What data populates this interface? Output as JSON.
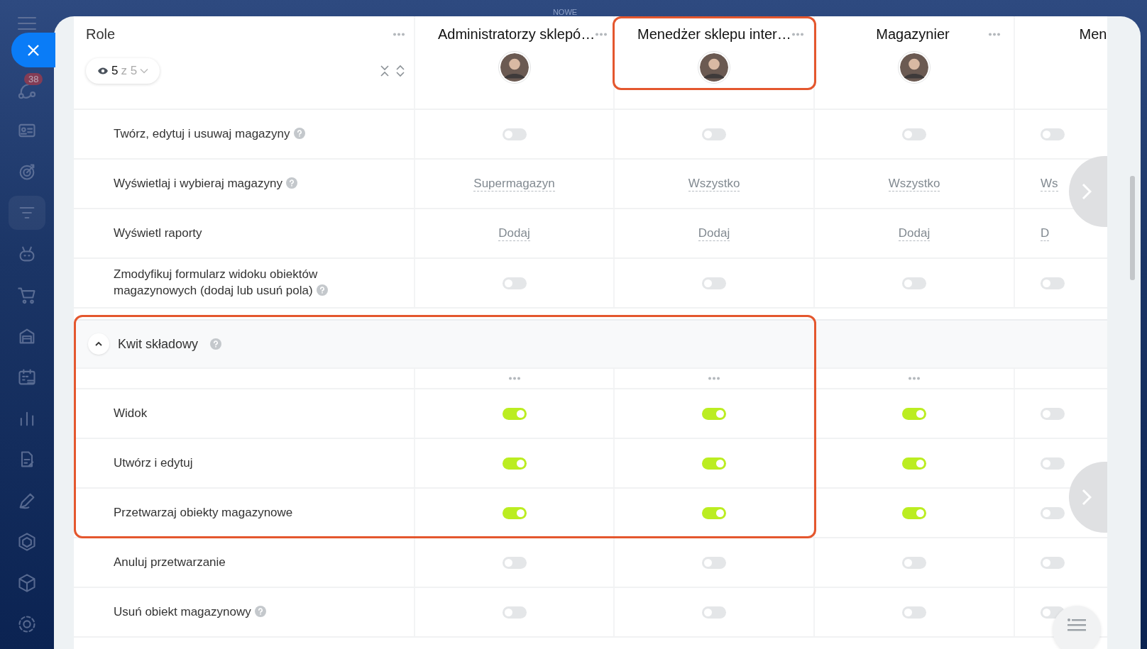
{
  "top_bar": {
    "label": "NOWE"
  },
  "sidebar": {
    "items": [
      {
        "selected": false,
        "badge": "38"
      },
      {
        "selected": false
      },
      {
        "selected": false
      },
      {
        "selected": true
      },
      {
        "selected": false
      },
      {
        "selected": false
      },
      {
        "selected": false
      },
      {
        "selected": false
      },
      {
        "selected": false
      },
      {
        "selected": false
      },
      {
        "selected": false
      },
      {
        "selected": false
      },
      {
        "selected": false
      },
      {
        "selected": false
      }
    ]
  },
  "roles_header": {
    "title": "Role",
    "filter": {
      "shown": "5",
      "total": "z 5"
    }
  },
  "roles": [
    {
      "name": "Administratorzy sklepó…",
      "avatar": true,
      "highlighted": false
    },
    {
      "name": "Menedżer sklepu inter…",
      "avatar": true,
      "highlighted": true
    },
    {
      "name": "Magazynier",
      "avatar": true,
      "highlighted": false
    },
    {
      "name": "Men",
      "avatar": false,
      "highlighted": false
    }
  ],
  "rows": [
    {
      "kind": "toggle",
      "label": "Twórz, edytuj i usuwaj magazyny",
      "help": true,
      "cells": [
        {
          "on": false
        },
        {
          "on": false
        },
        {
          "on": false
        },
        {
          "on": false
        }
      ]
    },
    {
      "kind": "link",
      "label": "Wyświetlaj i wybieraj magazyny",
      "help": true,
      "cells": [
        {
          "text": "Supermagazyn"
        },
        {
          "text": "Wszystko"
        },
        {
          "text": "Wszystko"
        },
        {
          "text": "Ws"
        }
      ]
    },
    {
      "kind": "link",
      "label": "Wyświetl raporty",
      "help": false,
      "cells": [
        {
          "text": "Dodaj"
        },
        {
          "text": "Dodaj"
        },
        {
          "text": "Dodaj"
        },
        {
          "text": "D"
        }
      ]
    },
    {
      "kind": "toggle",
      "label": "Zmodyfikuj formularz widoku obiektów magazynowych (dodaj lub usuń pola)",
      "help": true,
      "cells": [
        {
          "on": false
        },
        {
          "on": false
        },
        {
          "on": false
        },
        {
          "on": false
        }
      ]
    },
    {
      "kind": "highlight",
      "rows": [
        {
          "kind": "section",
          "label": "Kwit składowy",
          "help": true,
          "expanded": true
        },
        {
          "kind": "dots"
        },
        {
          "kind": "toggle",
          "label": "Widok",
          "help": false,
          "cells": [
            {
              "on": true
            },
            {
              "on": true
            },
            {
              "on": true
            },
            {
              "on": false
            }
          ]
        },
        {
          "kind": "toggle",
          "label": "Utwórz i edytuj",
          "help": false,
          "cells": [
            {
              "on": true
            },
            {
              "on": true
            },
            {
              "on": true
            },
            {
              "on": false
            }
          ]
        },
        {
          "kind": "toggle",
          "label": "Przetwarzaj obiekty magazynowe",
          "help": false,
          "cells": [
            {
              "on": true
            },
            {
              "on": true
            },
            {
              "on": true
            },
            {
              "on": false
            }
          ]
        }
      ]
    },
    {
      "kind": "toggle",
      "label": "Anuluj przetwarzanie",
      "help": false,
      "cells": [
        {
          "on": false
        },
        {
          "on": false
        },
        {
          "on": false
        },
        {
          "on": false
        }
      ]
    },
    {
      "kind": "toggle",
      "label": "Usuń obiekt magazynowy",
      "help": true,
      "cells": [
        {
          "on": false
        },
        {
          "on": false
        },
        {
          "on": false
        },
        {
          "on": false
        }
      ]
    }
  ]
}
